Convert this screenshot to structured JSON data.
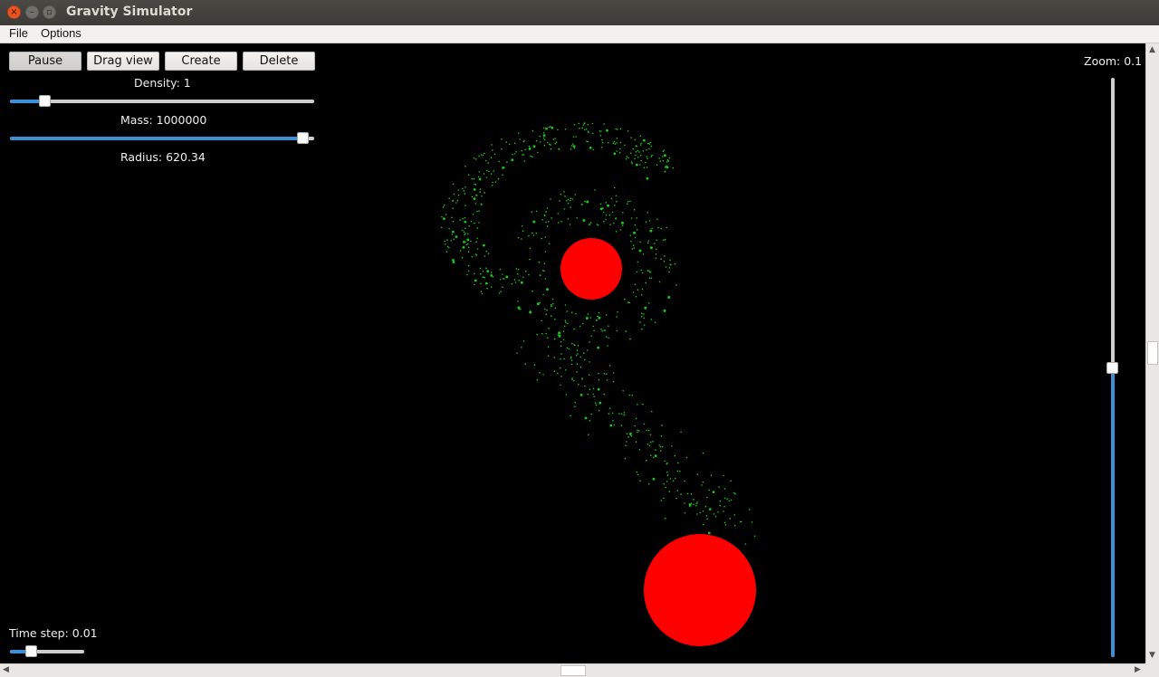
{
  "window": {
    "title": "Gravity Simulator"
  },
  "menu": {
    "file_label": "File",
    "options_label": "Options"
  },
  "toolbar": {
    "pause_label": "Pause",
    "drag_view_label": "Drag view",
    "create_label": "Create",
    "delete_label": "Delete"
  },
  "controls": {
    "density_label": "Density: 1",
    "density_value": 0.1,
    "mass_label": "Mass: 1000000",
    "mass_value": 0.98,
    "radius_label": "Radius: 620.34",
    "timestep_label": "Time step: 0.01",
    "timestep_value": 0.25,
    "zoom_label": "Zoom: 0.1",
    "zoom_value": 0.5
  },
  "scene": {
    "bodies": [
      {
        "color": "#ff0000",
        "name": "small-body"
      },
      {
        "color": "#ff0000",
        "name": "large-body"
      }
    ],
    "particle_color": "#19c819",
    "accent_color": "#3a8fd6"
  },
  "icons": {
    "close": "close-icon",
    "minimize": "minimize-icon",
    "maximize": "maximize-icon"
  }
}
